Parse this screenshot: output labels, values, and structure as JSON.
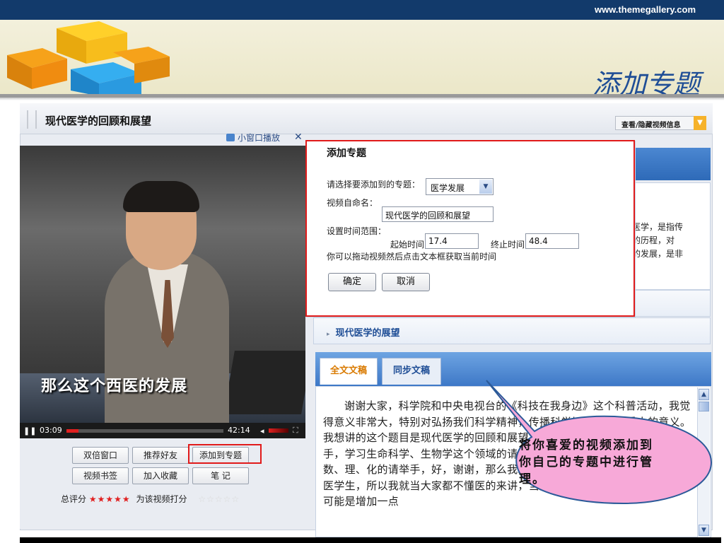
{
  "site": {
    "url": "www.themegallery.com"
  },
  "slide": {
    "title": "添加专题"
  },
  "player": {
    "video_title": "现代医学的回顾和展望",
    "toggle_info": "查看/隐藏视频信息",
    "mini_window": "小窗口播放",
    "caption": "那么这个西医的发展",
    "current_time": "03:09",
    "total_time": "42:14",
    "progress": 0.075,
    "buttons": {
      "double_window": "双倍窗口",
      "recommend": "推荐好友",
      "add_topic": "添加到专题",
      "bookmark": "视频书签",
      "favorite": "加入收藏",
      "notes": "笔  记"
    },
    "rating": {
      "label": "总评分",
      "stars": "★★★★★",
      "rate_label": "为该视频打分",
      "empty_stars": "☆☆☆☆☆"
    }
  },
  "dialog": {
    "title": "添加专题",
    "select_label": "请选择要添加到的专题：",
    "select_value": "医学发展",
    "name_label": "视频自命名：",
    "name_value": "现代医学的回顾和展望",
    "time_range_label": "设置时间范围：",
    "start_label": "起始时间",
    "start_value": "17.4",
    "end_label": "终止时间",
    "end_value": "48.4",
    "hint": "你可以拖动视频然后点击文本框获取当前时间",
    "confirm": "确定",
    "cancel": "取消"
  },
  "description": {
    "line1": "医学，是指传",
    "line2": "的历程，对",
    "line3": "的发展，是非"
  },
  "outline": {
    "item": "现代医学的展望"
  },
  "tabs": {
    "full_text": "全文文稿",
    "sync_text": "同步文稿"
  },
  "transcript": "谢谢大家，科学院和中央电视台的《科技在我身边》这个科普活动，我觉得意义非常大，特别对弘扬我们科学精神，传播科学知识是有很重大的意义。我想讲的这个题目是现代医学的回顾和展望，好，我们这里有学医学的请举手，学习生命科学、生物学这个领域的请举手，还要多，那么学习理科的，数、理、化的请举手，好，谢谢，那么我就知道大概怎么回事，因为只有一位医学生，所以我就当大家都不懂医的来讲，当然我要讲医学，大家又不懂医，可能是增加一点",
  "callout": {
    "text": "将你喜爱的视频添加到你自己的专题中进行管理。"
  }
}
